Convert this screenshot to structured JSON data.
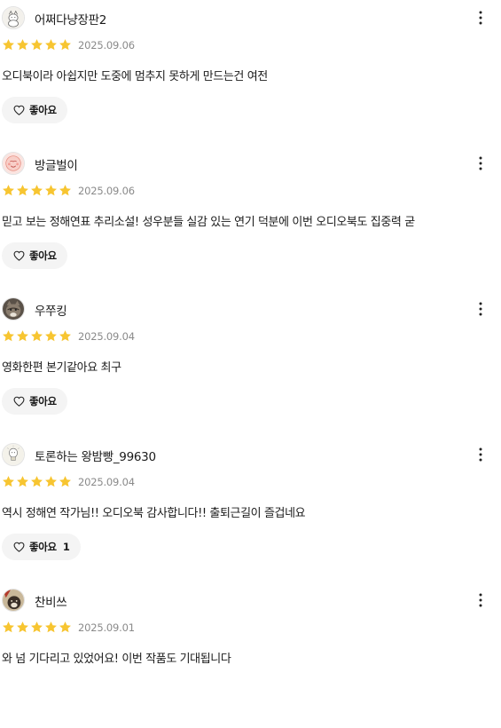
{
  "colors": {
    "star": "#f7c531",
    "date": "#8a8a8a",
    "like_bg": "#f4f4f4"
  },
  "icons": {
    "star": "star-icon",
    "more": "more-vertical-icon",
    "like": "heart-outline-icon"
  },
  "reviews": [
    {
      "nickname": "어쩌다냥장판2",
      "rating": 5,
      "date": "2025.09.06",
      "text": "오디북이라 아쉽지만 도중에 멈추지 못하게 만드는건 여전",
      "like_label": "좋아요",
      "like_count": "",
      "avatar": "cat-sketch-avatar"
    },
    {
      "nickname": "방글벌이",
      "rating": 5,
      "date": "2025.09.06",
      "text": "믿고 보는 정해연표 추리소설!  성우분들 실감 있는 연기 덕분에 이번 오디오북도 집중력 굳",
      "like_label": "좋아요",
      "like_count": "",
      "avatar": "pink-face-avatar"
    },
    {
      "nickname": "우쭈킹",
      "rating": 5,
      "date": "2025.09.04",
      "text": "영화한편 본기같아요 최구",
      "like_label": "좋아요",
      "like_count": "",
      "avatar": "cat-photo-avatar"
    },
    {
      "nickname": "토론하는 왕밤빵_99630",
      "rating": 5,
      "date": "2025.09.04",
      "text": "역시 정해연 작가님!! 오디오북 감사합니다!! 출퇴근길이 즐겁네요",
      "like_label": "좋아요",
      "like_count": "1",
      "avatar": "bulb-sketch-avatar"
    },
    {
      "nickname": "찬비쓰",
      "rating": 5,
      "date": "2025.09.01",
      "text": "와 넘 기다리고 있었어요! 이번 작품도 기대됩니다",
      "like_label": "좋아요",
      "like_count": "",
      "avatar": "dog-photo-avatar"
    }
  ]
}
